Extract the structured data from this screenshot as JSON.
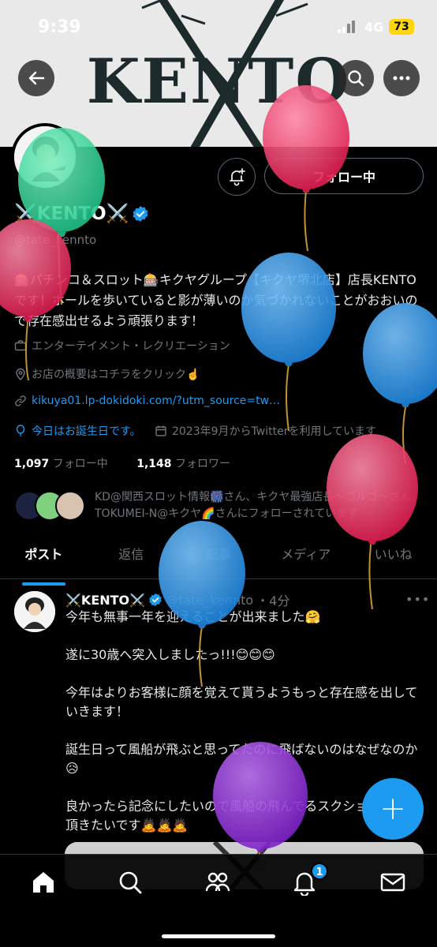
{
  "status_bar": {
    "time": "9:39",
    "network": "4G",
    "battery": "73"
  },
  "banner": {
    "text": "KENTO"
  },
  "header_actions": {
    "back_icon": "back-arrow-icon",
    "search_icon": "search-icon",
    "more_icon": "more-icon"
  },
  "profile": {
    "follow_label": "フォロー中",
    "name": "⚔️KENTO⚔️",
    "handle": "@tate_kennto",
    "bio": "🎰パチンコ＆スロット🎰キクヤグループ【キクヤ堺北店】店長KENTOです！ホールを歩いていると影が薄いのか気づかれないことがおおいので存在感出せるよう頑張ります！",
    "category": "エンターテイメント・レクリエーション",
    "location": "お店の概要はコチラをクリック☝️",
    "link": "kikuya01.lp-dokidoki.com/?utm_source=tw…",
    "birthday": "今日はお誕生日です。",
    "joined": "2023年9月からTwitterを利用しています",
    "following_count": "1,097",
    "following_label": "フォロー中",
    "followers_count": "1,148",
    "followers_label": "フォロワー",
    "mutual_text": "KD@関西スロット情報🎆さん、キクヤ最強店長～ゴルゴ～さん、TOKUMEI-N@キクヤ🌈さんにフォローされています"
  },
  "tabs": [
    {
      "label": "ポスト",
      "active": true
    },
    {
      "label": "返信",
      "active": false
    },
    {
      "label": "記事",
      "active": false
    },
    {
      "label": "メディア",
      "active": false
    },
    {
      "label": "いいね",
      "active": false
    }
  ],
  "post": {
    "name": "⚔️KENTO⚔️",
    "handle": "@tate_kennto",
    "time": "・4分",
    "more": "•••",
    "paragraphs": [
      "今年も無事一年を迎えることが出来ました🤗",
      "遂に30歳へ突入しましたっ!!!😊😊😊",
      "今年はよりお客様に顔を覚えて貰うようもっと存在感を出していきます！",
      "誕生日って風船が飛ぶと思ってたのに飛ばないのはなぜなのか😥",
      "良かったら記念にしたいので風船の飛んでるスクショ撮れたら頂きたいです🙇🙇🙇"
    ]
  },
  "fab": {
    "label": "+"
  },
  "bottom_nav": {
    "notification_count": "1"
  },
  "colors": {
    "accent": "#1d9bf0",
    "background": "#000000",
    "battery": "#ffd60a"
  }
}
